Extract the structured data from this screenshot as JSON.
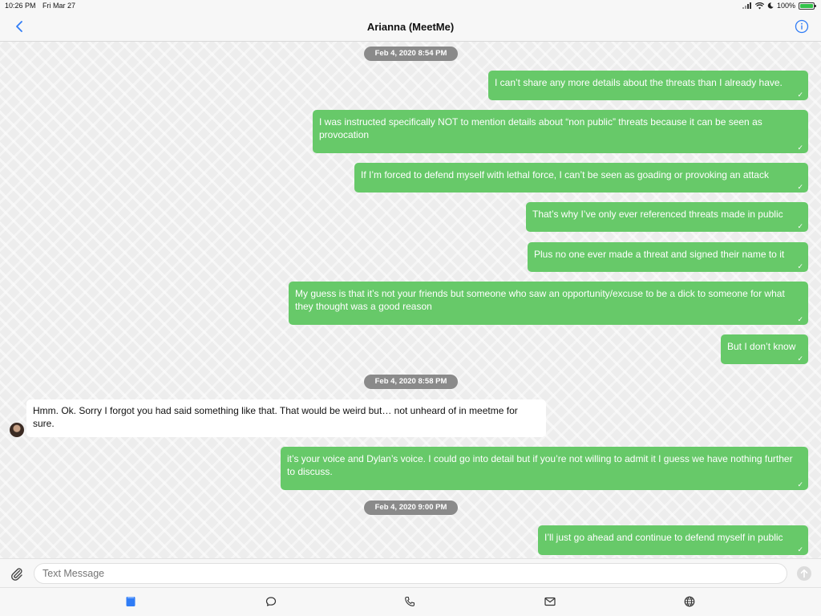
{
  "status_bar": {
    "time": "10:26 PM",
    "date": "Fri Mar 27",
    "battery": "100%"
  },
  "header": {
    "title": "Arianna (MeetMe)",
    "back_icon": "chevron-left-icon",
    "info_icon": "info-circle-icon"
  },
  "timestamps": [
    "Feb 4, 2020 8:54 PM",
    "Feb 4, 2020 8:58 PM",
    "Feb 4, 2020 9:00 PM"
  ],
  "messages": [
    {
      "direction": "out",
      "text": "I can’t share any more details about the threats than I already have."
    },
    {
      "direction": "out",
      "text": "I was instructed specifically NOT to mention details about “non public” threats because it can be seen as provocation"
    },
    {
      "direction": "out",
      "text": "If I’m forced to defend myself with lethal force, I can’t be seen as goading or provoking an attack"
    },
    {
      "direction": "out",
      "text": "That’s why I’ve only ever referenced threats made in public"
    },
    {
      "direction": "out",
      "text": "Plus no one ever made a threat and signed their name to it"
    },
    {
      "direction": "out",
      "text": "My guess is that it’s not your friends but someone who saw an opportunity/excuse to be a dick to someone for what they thought was a good reason"
    },
    {
      "direction": "out",
      "text": "But I don’t know"
    },
    {
      "direction": "in",
      "text": "Hmm. Ok. Sorry I forgot you had said something like that. That would be weird but… not unheard of in meetme for sure."
    },
    {
      "direction": "out",
      "text": "it’s your voice and Dylan’s voice. I could go into detail but if you’re not willing to admit it I guess we have nothing further to discuss."
    },
    {
      "direction": "out",
      "text": "I’ll just go ahead and continue to defend myself in public"
    }
  ],
  "read_mark": "✓",
  "composer": {
    "placeholder": "Text Message"
  },
  "tabs": [
    {
      "icon": "messages-square-icon",
      "active": true
    },
    {
      "icon": "chat-bubble-icon",
      "active": false
    },
    {
      "icon": "phone-icon",
      "active": false
    },
    {
      "icon": "mail-icon",
      "active": false
    },
    {
      "icon": "globe-icon",
      "active": false
    }
  ],
  "colors": {
    "outgoing_bubble": "#67c969",
    "incoming_bubble": "#ffffff",
    "accent": "#2f7cf6",
    "timestamp_pill": "#8a8a8a"
  }
}
